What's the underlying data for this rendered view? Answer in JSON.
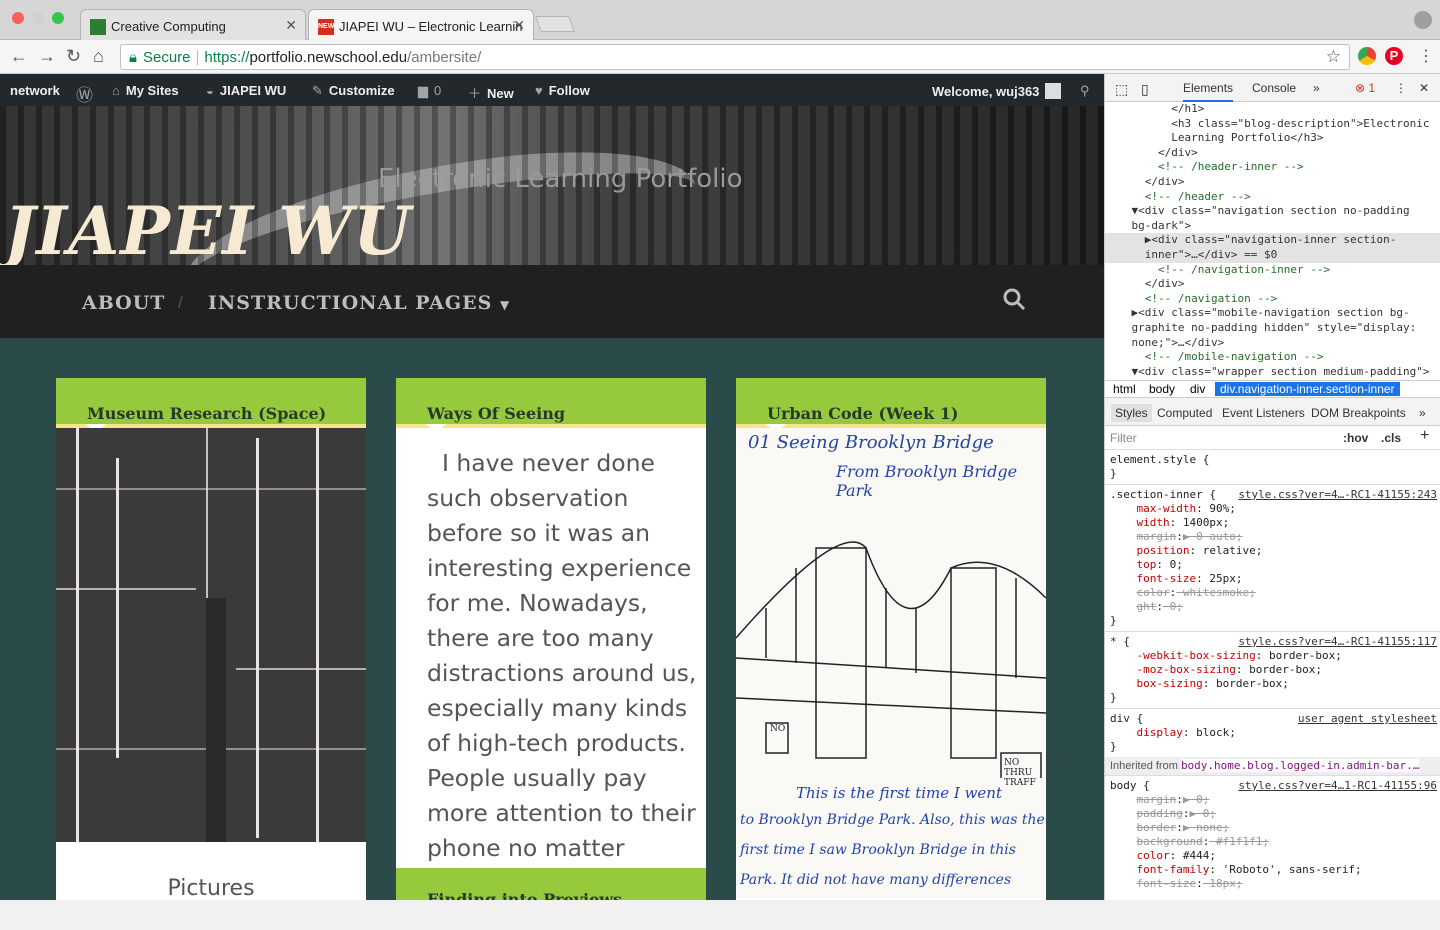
{
  "browser": {
    "tabs": [
      {
        "title": "Creative Computing",
        "active": false
      },
      {
        "title": "JIAPEI WU – Electronic Learnin",
        "active": true
      }
    ],
    "secure_label": "Secure",
    "url_scheme": "https://",
    "url_host": "portfolio.newschool.edu",
    "url_path": "/ambersite/"
  },
  "wp_admin_bar": {
    "network": "network",
    "my_sites": "My Sites",
    "site_name": "JIAPEI WU",
    "customize": "Customize",
    "comments_count": "0",
    "new": "New",
    "follow": "Follow",
    "welcome": "Welcome, wuj363"
  },
  "site": {
    "description": "Electronic Learning Portfolio",
    "title": "JIAPEI WU",
    "nav": [
      "ABOUT",
      "INSTRUCTIONAL PAGES"
    ]
  },
  "posts": [
    {
      "title": "Museum Research (Space)",
      "footer_text": "Pictures"
    },
    {
      "title": "Ways Of Seeing",
      "excerpt": "  I have never done such observation before so it was an interesting experience for me. Nowadays, there are too many distractions around us, especially many kinds of high-tech products. People usually pay more attention to their phone no matter",
      "next_title": "Finding into Previews"
    },
    {
      "title": "Urban Code (Week 1)",
      "sketch_lines": [
        "01  Seeing Brooklyn Bridge",
        "From Brooklyn Bridge Park",
        "This is the first time I went",
        "to Brooklyn Bridge Park. Also, this was the",
        "first time I saw Brooklyn Bridge in this",
        "Park. It did not have many differences"
      ],
      "sign_no": "NO",
      "sign_thru": "NO THRU TRAFF"
    }
  ],
  "devtools": {
    "tabs": [
      "Elements",
      "Console"
    ],
    "error_count": "1",
    "dom_lines": [
      "          </h1>",
      "          <h3 class=\"blog-description\">Electronic",
      "          Learning Portfolio</h3>",
      "        </div>",
      "        <!-- /header-inner -->",
      "      </div>",
      "      <!-- /header -->",
      "    ▼<div class=\"navigation section no-padding",
      "    bg-dark\">",
      "      ▶<div class=\"navigation-inner section-",
      "      inner\">…</div> == $0",
      "        <!-- /navigation-inner -->",
      "      </div>",
      "      <!-- /navigation -->",
      "    ▶<div class=\"mobile-navigation section bg-",
      "    graphite no-padding hidden\" style=\"display:",
      "    none;\">…</div>",
      "      <!-- /mobile-navigation -->",
      "    ▼<div class=\"wrapper section medium-padding\">",
      "      ▼<div class=\"content section-inner\">"
    ],
    "breadcrumbs": [
      "html",
      "body",
      "div",
      "div.navigation-inner.section-inner"
    ],
    "style_tabs": [
      "Styles",
      "Computed",
      "Event Listeners",
      "DOM Breakpoints"
    ],
    "filter_placeholder": "Filter",
    "hov": ":hov",
    "cls": ".cls",
    "rules": [
      {
        "lines": [
          "element.style {",
          "}"
        ]
      },
      {
        "source": "style.css?ver=4…-RC1-41155:243",
        "lines": [
          ".section-inner {",
          "    max-width: 90%;",
          "    width: 1400px;",
          "    margin:▶ 0 auto;",
          "    position: relative;",
          "    top: 0;",
          "    font-size: 25px;",
          "    color: whitesmoke;",
          "    ght: 0;",
          "}"
        ]
      },
      {
        "source": "style.css?ver=4…-RC1-41155:117",
        "lines": [
          "* {",
          "    -webkit-box-sizing: border-box;",
          "    -moz-box-sizing: border-box;",
          "    box-sizing: border-box;",
          "}"
        ]
      },
      {
        "source": "user agent stylesheet",
        "lines": [
          "div {",
          "    display: block;",
          "}"
        ]
      }
    ],
    "inherited_label": "Inherited from",
    "inherited_from": "body.home.blog.logged-in.admin-bar.…",
    "body_rule": {
      "source": "style.css?ver=4…1-RC1-41155:96",
      "lines": [
        "body {",
        "    margin:▶ 0;",
        "    padding:▶ 0;",
        "    border:▶ none;",
        "    background: #f1f1f1;",
        "    color: #444;",
        "    font-family: 'Roboto', sans-serif;",
        "    font-size: 18px;"
      ]
    }
  }
}
